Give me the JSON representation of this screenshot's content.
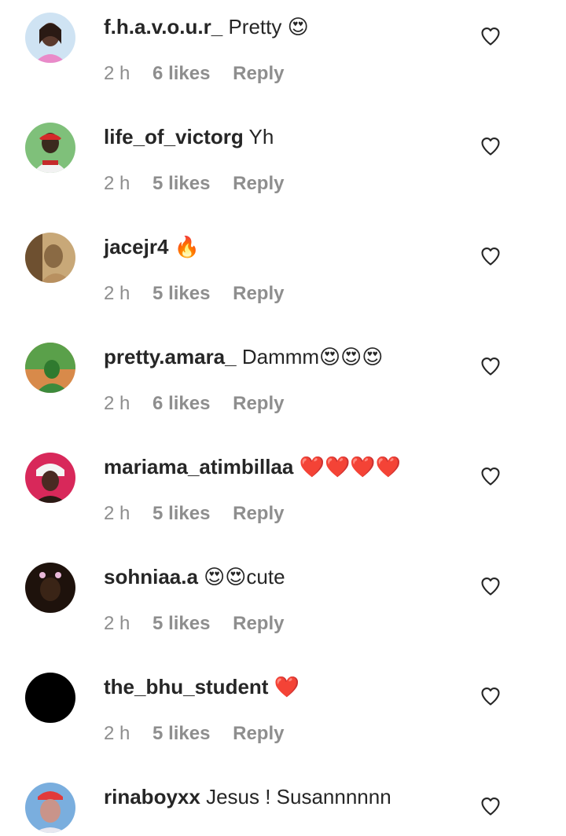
{
  "comments": [
    {
      "username": "f.h.a.v.o.u.r_",
      "text": "Pretty 😍",
      "time": "2 h",
      "likes": "6 likes",
      "reply": "Reply",
      "avatar_color": "#5a3a2e",
      "avatar_bg": "#cfe3f3"
    },
    {
      "username": "life_of_victorg",
      "text": "Yh",
      "time": "2 h",
      "likes": "5 likes",
      "reply": "Reply",
      "avatar_color": "#3a2a1e",
      "avatar_bg": "#7fc07a"
    },
    {
      "username": "jacejr4",
      "text": " 🔥",
      "time": "2 h",
      "likes": "5 likes",
      "reply": "Reply",
      "avatar_color": "#8a6a44",
      "avatar_bg": "#c8a878"
    },
    {
      "username": "pretty.amara_",
      "text": "Dammm😍😍😍",
      "time": "2 h",
      "likes": "6 likes",
      "reply": "Reply",
      "avatar_color": "#2f7a2f",
      "avatar_bg": "#d88a4a"
    },
    {
      "username": "mariama_atimbillaa",
      "text": "❤️❤️❤️❤️",
      "time": "2 h",
      "likes": "5 likes",
      "reply": "Reply",
      "avatar_color": "#4a2a22",
      "avatar_bg": "#d8285a"
    },
    {
      "username": "sohniaa.a",
      "text": "😍😍cute",
      "time": "2 h",
      "likes": "5 likes",
      "reply": "Reply",
      "avatar_color": "#3a2416",
      "avatar_bg": "#1e120c"
    },
    {
      "username": "the_bhu_student",
      "text": "❤️",
      "time": "2 h",
      "likes": "5 likes",
      "reply": "Reply",
      "avatar_color": "#000000",
      "avatar_bg": "#000000"
    },
    {
      "username": "rinaboyxx",
      "text": "Jesus ! Susannnnnn",
      "time": "",
      "likes": "",
      "reply": "",
      "avatar_color": "#c9948a",
      "avatar_bg": "#7aaede"
    }
  ],
  "colors": {
    "text_primary": "#262626",
    "text_secondary": "#8e8e8e",
    "background": "#ffffff"
  },
  "icons": {
    "like": "heart-outline-icon"
  }
}
